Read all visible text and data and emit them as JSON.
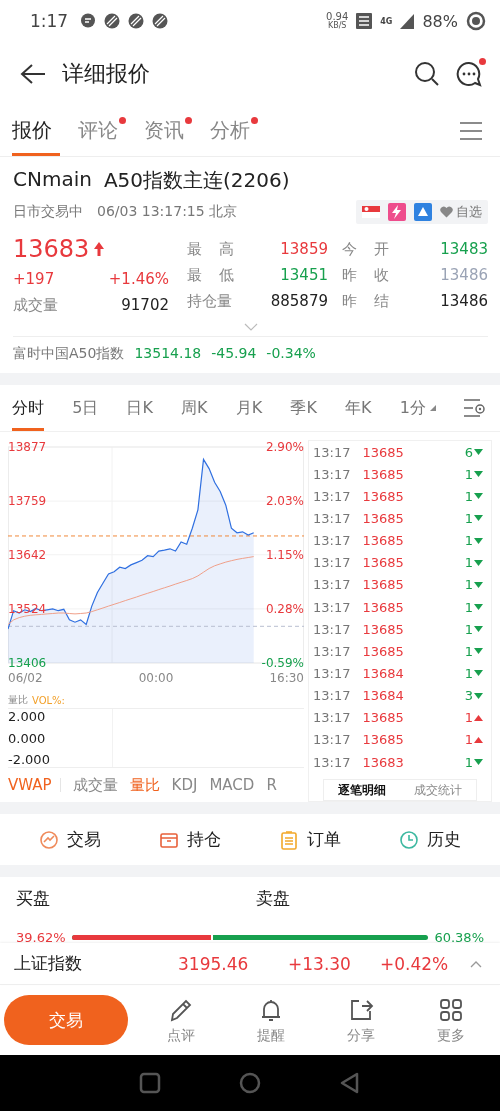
{
  "status_bar": {
    "time": "1:17",
    "net_speed": "0.94",
    "net_unit": "KB/S",
    "network": "4G",
    "battery": "88%"
  },
  "header": {
    "title": "详细报价",
    "message_badge": true
  },
  "tabs": [
    {
      "label": "报价",
      "selected": true,
      "badge": false
    },
    {
      "label": "评论",
      "selected": false,
      "badge": true
    },
    {
      "label": "资讯",
      "selected": false,
      "badge": true
    },
    {
      "label": "分析",
      "selected": false,
      "badge": true
    }
  ],
  "quote": {
    "symbol": "CNmain",
    "name": "A50指数主连(2206)",
    "session": "日市交易中",
    "timestamp": "06/03 13:17:15 北京",
    "watch_label": "自选",
    "price": "13683",
    "up": true,
    "change": "+197",
    "change_pct": "+1.46%",
    "volume_label": "成交量",
    "volume": "91702",
    "stats": [
      {
        "label": "最 高",
        "value": "13859",
        "color": "#e8393d"
      },
      {
        "label": "今 开",
        "value": "13483",
        "color": "#17a04e"
      },
      {
        "label": "最 低",
        "value": "13451",
        "color": "#17a04e"
      },
      {
        "label": "昨 收",
        "value": "13486",
        "color": "#9aa3b5"
      },
      {
        "label": "持仓量",
        "value": "885879",
        "color": "#222222"
      },
      {
        "label": "昨 结",
        "value": "13486",
        "color": "#222222"
      }
    ],
    "index": {
      "name": "富时中国A50指数",
      "value": "13514.18",
      "change": "-45.94",
      "change_pct": "-0.34%",
      "color": "#17a04e"
    }
  },
  "periods": [
    {
      "label": "分时",
      "selected": true,
      "dropdown": false
    },
    {
      "label": "5日",
      "selected": false,
      "dropdown": false
    },
    {
      "label": "日K",
      "selected": false,
      "dropdown": false
    },
    {
      "label": "周K",
      "selected": false,
      "dropdown": false
    },
    {
      "label": "月K",
      "selected": false,
      "dropdown": false
    },
    {
      "label": "季K",
      "selected": false,
      "dropdown": false
    },
    {
      "label": "年K",
      "selected": false,
      "dropdown": false
    },
    {
      "label": "1分",
      "selected": false,
      "dropdown": true
    }
  ],
  "chart": {
    "percent_labels": [
      {
        "label": "2.90%",
        "color": "#e8393d"
      },
      {
        "label": "2.03%",
        "color": "#e8393d"
      },
      {
        "label": "1.15%",
        "color": "#e8393d"
      },
      {
        "label": "0.28%",
        "color": "#e8393d"
      },
      {
        "label": "-0.59%",
        "color": "#17a04e"
      }
    ],
    "time_labels": [
      "06/02",
      "00:00",
      "16:30"
    ],
    "chart_data": {
      "type": "area",
      "grid": true,
      "ylim": [
        13406,
        13877
      ],
      "ref_lines": [
        {
          "axis": "y",
          "value": 13683,
          "color": "#f0883a"
        },
        {
          "axis": "y",
          "value": 13486,
          "color": "#b8bfd0"
        }
      ],
      "yticks": [
        {
          "value": 13877,
          "label": "13877"
        },
        {
          "value": 13759,
          "label": "13759"
        },
        {
          "value": 13642,
          "label": "13642"
        },
        {
          "value": 13524,
          "label": "13524"
        },
        {
          "value": 13406,
          "label": "13406"
        }
      ],
      "categories": [
        null,
        null,
        null,
        null,
        null,
        null,
        null,
        null,
        null,
        null,
        null,
        null,
        null,
        null,
        null,
        null,
        null,
        null,
        null,
        null,
        null,
        null,
        null,
        null,
        null,
        null,
        null,
        null,
        null,
        null,
        null,
        null,
        null,
        null,
        null,
        null,
        null,
        null,
        null,
        null,
        null,
        null,
        null,
        null,
        null,
        null,
        null,
        null,
        null,
        null,
        null,
        null,
        null,
        null
      ],
      "series": [
        {
          "color": "#2f6fe0",
          "values": [
            13480,
            13520,
            13515,
            13522,
            13518,
            13525,
            13520,
            13522,
            13524,
            13520,
            13523,
            13500,
            13495,
            13500,
            13490,
            13530,
            13560,
            13580,
            13600,
            13605,
            13615,
            13612,
            13620,
            13625,
            13630,
            13640,
            13638,
            13650,
            13652,
            13655,
            13650,
            13670,
            13665,
            13700,
            13740,
            13850,
            13830,
            13800,
            13780,
            13750,
            13700,
            13690,
            13692,
            13685,
            13690,
            null,
            null,
            null,
            null,
            null,
            null,
            null,
            null,
            null
          ]
        },
        {
          "type": "line",
          "color": "#f0a08a",
          "values": [
            13490,
            13500,
            13505,
            13508,
            13510,
            13511,
            13512,
            13513,
            13514,
            13515,
            13515,
            13514,
            13513,
            13514,
            13515,
            13518,
            13522,
            13526,
            13530,
            13534,
            13538,
            13542,
            13546,
            13550,
            13554,
            13558,
            13562,
            13566,
            13570,
            13574,
            13578,
            13582,
            13586,
            13590,
            13596,
            13604,
            13612,
            13618,
            13622,
            13626,
            13629,
            13632,
            13634,
            13636,
            13638,
            null,
            null,
            null,
            null,
            null,
            null,
            null,
            null,
            null
          ]
        }
      ]
    },
    "sub_title": "量比",
    "sub_indicator": "VOL%:",
    "sub_labels": [
      "2.000",
      "0.000",
      "-2.000"
    ]
  },
  "indicators": [
    {
      "label": "VWAP",
      "selected": true
    },
    {
      "label": "成交量",
      "selected": false
    },
    {
      "label": "量比",
      "selected": true
    },
    {
      "label": "KDJ",
      "selected": false
    },
    {
      "label": "MACD",
      "selected": false
    },
    {
      "label": "R",
      "selected": false
    }
  ],
  "ticks": [
    {
      "time": "13:17",
      "price": "13685",
      "volume": "6",
      "up": false
    },
    {
      "time": "13:17",
      "price": "13685",
      "volume": "1",
      "up": false
    },
    {
      "time": "13:17",
      "price": "13685",
      "volume": "1",
      "up": false
    },
    {
      "time": "13:17",
      "price": "13685",
      "volume": "1",
      "up": false
    },
    {
      "time": "13:17",
      "price": "13685",
      "volume": "1",
      "up": false
    },
    {
      "time": "13:17",
      "price": "13685",
      "volume": "1",
      "up": false
    },
    {
      "time": "13:17",
      "price": "13685",
      "volume": "1",
      "up": false
    },
    {
      "time": "13:17",
      "price": "13685",
      "volume": "1",
      "up": false
    },
    {
      "time": "13:17",
      "price": "13685",
      "volume": "1",
      "up": false
    },
    {
      "time": "13:17",
      "price": "13685",
      "volume": "1",
      "up": false
    },
    {
      "time": "13:17",
      "price": "13684",
      "volume": "1",
      "up": false
    },
    {
      "time": "13:17",
      "price": "13684",
      "volume": "3",
      "up": false
    },
    {
      "time": "13:17",
      "price": "13685",
      "volume": "1",
      "up": true
    },
    {
      "time": "13:17",
      "price": "13685",
      "volume": "1",
      "up": true
    },
    {
      "time": "13:17",
      "price": "13683",
      "volume": "1",
      "up": false
    }
  ],
  "tick_tabs": [
    {
      "label": "逐笔明细",
      "selected": true
    },
    {
      "label": "成交统计",
      "selected": false
    }
  ],
  "actions": [
    {
      "label": "交易",
      "kind": "trade"
    },
    {
      "label": "持仓",
      "kind": "position"
    },
    {
      "label": "订单",
      "kind": "order"
    },
    {
      "label": "历史",
      "kind": "history"
    }
  ],
  "order_book": {
    "buy_label": "买盘",
    "sell_label": "卖盘",
    "buy_pct": "39.62%",
    "sell_pct": "60.38%",
    "level": 0.3962
  },
  "market_index": {
    "name": "上证指数",
    "value": "3195.46",
    "change": "+13.30",
    "change_pct": "+0.42%",
    "color": "#e8393d"
  },
  "bottom_nav": {
    "primary": "交易",
    "items": [
      {
        "label": "点评",
        "kind": "comment"
      },
      {
        "label": "提醒",
        "kind": "alert"
      },
      {
        "label": "分享",
        "kind": "share"
      },
      {
        "label": "更多",
        "kind": "more"
      }
    ]
  }
}
